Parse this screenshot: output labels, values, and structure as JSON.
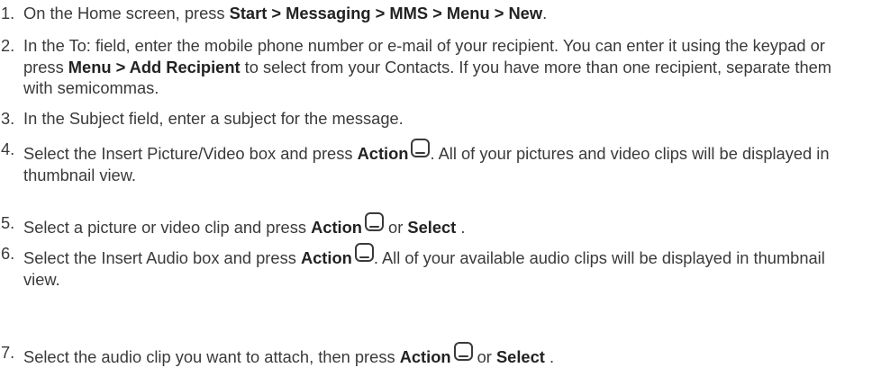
{
  "steps": [
    {
      "number": "1.",
      "t1": "On the Home screen, press ",
      "b1": "Start  > Messaging > MMS > Menu > New",
      "t2": "."
    },
    {
      "number": "2.",
      "t1": "In the To: field, enter the mobile phone number or e-mail of your recipient. You can enter it using the keypad or press ",
      "b1": "Menu  > Add Recipient",
      "t2": " to select from your Contacts. If you have more than one recipient, separate them with semicommas."
    },
    {
      "number": "3.",
      "t1": "In the Subject field, enter a subject for the message."
    },
    {
      "number": "4.",
      "t1": "Select the Insert Picture/Video box and press ",
      "b1": "Action",
      "icon": "action-button-icon",
      "t2": ". All of your pictures and video clips will be displayed in thumbnail view."
    },
    {
      "number": "5.",
      "t1": "Select a picture or video clip and press ",
      "b1": "Action",
      "icon": "action-button-icon",
      "t2": " or ",
      "b2": "Select",
      "t3": " ."
    },
    {
      "number": "6.",
      "t1": "Select the Insert Audio box and press ",
      "b1": "Action",
      "icon": "action-button-icon",
      "t2": ". All of your available audio clips will be displayed in thumbnail view."
    },
    {
      "number": "7.",
      "t1": "Select the audio clip you want to attach, then press ",
      "b1": "Action",
      "icon": "action-button-icon",
      "t2": " or ",
      "b2": "Select",
      "t3": " ."
    }
  ]
}
